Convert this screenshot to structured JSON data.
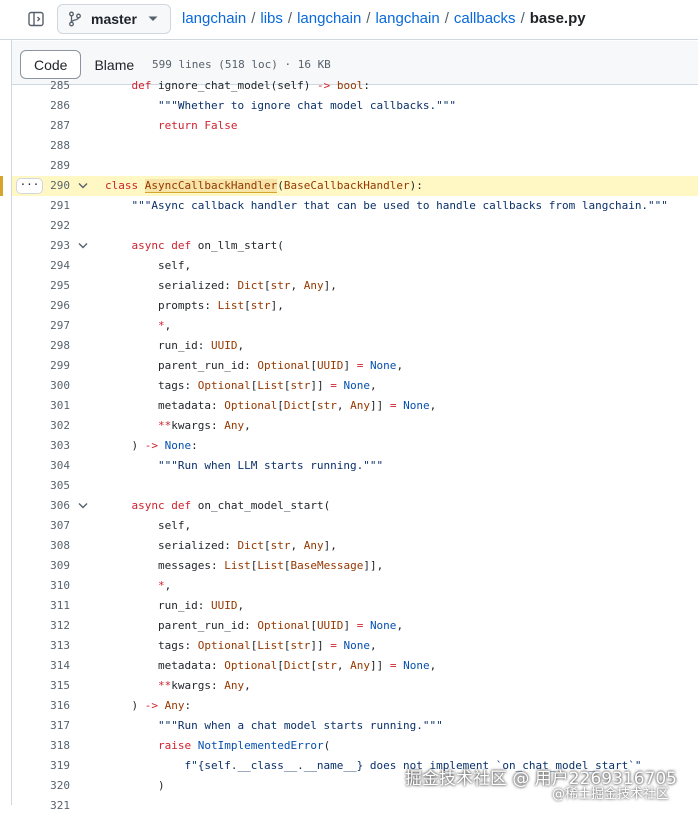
{
  "header": {
    "branch": "master",
    "breadcrumb": {
      "parts": [
        "langchain",
        "libs",
        "langchain",
        "langchain",
        "callbacks"
      ],
      "current": "base.py"
    }
  },
  "toolbar": {
    "code_tab": "Code",
    "blame_tab": "Blame",
    "file_meta": "599 lines (518 loc) · 16 KB"
  },
  "code_lines": [
    {
      "n": "285",
      "t": "    def ignore_chat_model(self) -> bool:"
    },
    {
      "n": "286",
      "t": "        \"\"\"Whether to ignore chat model callbacks.\"\"\""
    },
    {
      "n": "287",
      "t": "        return False"
    },
    {
      "n": "288",
      "t": ""
    },
    {
      "n": "289",
      "t": ""
    },
    {
      "n": "290",
      "t": "class AsyncCallbackHandler(BaseCallbackHandler):"
    },
    {
      "n": "291",
      "t": "    \"\"\"Async callback handler that can be used to handle callbacks from langchain.\"\"\""
    },
    {
      "n": "292",
      "t": ""
    },
    {
      "n": "293",
      "t": "    async def on_llm_start("
    },
    {
      "n": "294",
      "t": "        self,"
    },
    {
      "n": "295",
      "t": "        serialized: Dict[str, Any],"
    },
    {
      "n": "296",
      "t": "        prompts: List[str],"
    },
    {
      "n": "297",
      "t": "        *,"
    },
    {
      "n": "298",
      "t": "        run_id: UUID,"
    },
    {
      "n": "299",
      "t": "        parent_run_id: Optional[UUID] = None,"
    },
    {
      "n": "300",
      "t": "        tags: Optional[List[str]] = None,"
    },
    {
      "n": "301",
      "t": "        metadata: Optional[Dict[str, Any]] = None,"
    },
    {
      "n": "302",
      "t": "        **kwargs: Any,"
    },
    {
      "n": "303",
      "t": "    ) -> None:"
    },
    {
      "n": "304",
      "t": "        \"\"\"Run when LLM starts running.\"\"\""
    },
    {
      "n": "305",
      "t": ""
    },
    {
      "n": "306",
      "t": "    async def on_chat_model_start("
    },
    {
      "n": "307",
      "t": "        self,"
    },
    {
      "n": "308",
      "t": "        serialized: Dict[str, Any],"
    },
    {
      "n": "309",
      "t": "        messages: List[List[BaseMessage]],"
    },
    {
      "n": "310",
      "t": "        *,"
    },
    {
      "n": "311",
      "t": "        run_id: UUID,"
    },
    {
      "n": "312",
      "t": "        parent_run_id: Optional[UUID] = None,"
    },
    {
      "n": "313",
      "t": "        tags: Optional[List[str]] = None,"
    },
    {
      "n": "314",
      "t": "        metadata: Optional[Dict[str, Any]] = None,"
    },
    {
      "n": "315",
      "t": "        **kwargs: Any,"
    },
    {
      "n": "316",
      "t": "    ) -> Any:"
    },
    {
      "n": "317",
      "t": "        \"\"\"Run when a chat model starts running.\"\"\""
    },
    {
      "n": "318",
      "t": "        raise NotImplementedError("
    },
    {
      "n": "319",
      "t": "            f\"{self.__class__.__name__} does not implement `on_chat_model_start`\""
    },
    {
      "n": "320",
      "t": "        )"
    },
    {
      "n": "321",
      "t": ""
    }
  ],
  "highlighted_line": "290",
  "highlighted_symbol": "AsyncCallbackHandler",
  "fold_lines": [
    "290",
    "293",
    "306"
  ],
  "more_button": "···",
  "watermark": {
    "line1": "掘金技术社区 @ 用户2269316705",
    "line2": "@稀土掘金技术社区"
  },
  "colors": {
    "link": "#0969da",
    "keyword": "#cf222e",
    "string": "#0a3069",
    "type": "#953800",
    "constant": "#0550ae",
    "highlight_line": "#fff8c5"
  }
}
